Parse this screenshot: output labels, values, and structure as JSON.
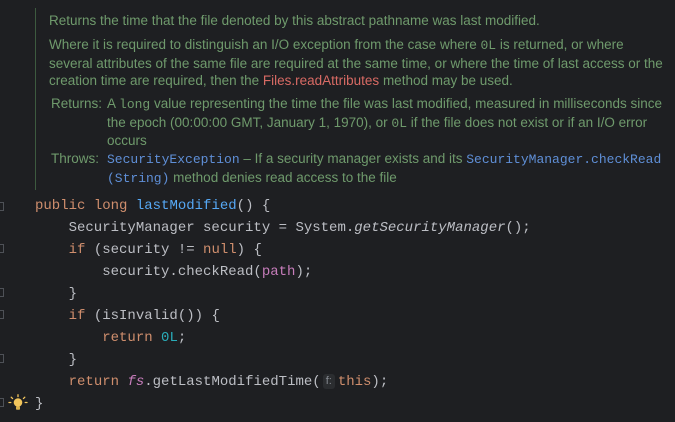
{
  "doc": {
    "summary": "Returns the time that the file denoted by this abstract pathname was last modified.",
    "para": {
      "text1": "Where it is required to distinguish an I/O exception from the case where ",
      "code": "0L",
      "text2": " is returned, or where several attributes of the same file are required at the same time, or where the time of last access or the creation time are required, then the ",
      "link": "Files.readAttributes",
      "text3": " method may be used."
    },
    "returns": {
      "label": "Returns:",
      "text1": "A ",
      "code1": "long",
      "text2": " value representing the time the file was last modified, measured in milliseconds since the epoch (00:00:00 GMT, January 1, 1970), or ",
      "code2": "0L",
      "text3": " if the file does not exist or if an I/O error occurs"
    },
    "throws": {
      "label": "Throws:",
      "exception": "SecurityException",
      "text1": " – If a security manager exists and its ",
      "ref": "SecurityManager.checkRead (String)",
      "text2": " method denies read access to the file"
    }
  },
  "code": {
    "line1": {
      "kw1": "public",
      "kw2": "long",
      "name": "lastModified",
      "rest": "() {"
    },
    "line2": {
      "a": "    SecurityManager security = System.",
      "call": "getSecurityManager",
      "b": "();"
    },
    "line3": {
      "kw": "if",
      "a": " (security != ",
      "null": "null",
      "b": ") {"
    },
    "line4": {
      "a": "        security.checkRead(",
      "field": "path",
      "b": ");"
    },
    "line5": "    }",
    "line6": {
      "kw": "if",
      "a": " (isInvalid()) {"
    },
    "line7": {
      "kw": "return",
      "num": "0L",
      "b": ";"
    },
    "line8": "    }",
    "line9": {
      "kw": "return",
      "field": "fs",
      "a": ".getLastModifiedTime(",
      "hint": "f:",
      "this": "this",
      "b": ");"
    },
    "line10": "}"
  },
  "icons": {
    "gutter": "fold-marker-icon",
    "intention": "lightbulb-icon"
  },
  "colors": {
    "background": "#1e1f22",
    "doc_text": "#6f9a6c",
    "keyword": "#cf8e6d",
    "method": "#56a8f5",
    "field": "#c77dbb",
    "number": "#2aacb8",
    "link_red": "#d86a64",
    "link_blue": "#5f8fd7"
  }
}
